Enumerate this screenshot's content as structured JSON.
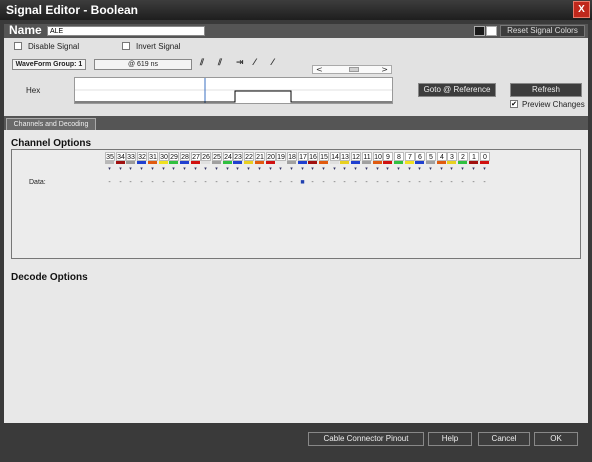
{
  "window": {
    "title": "Signal Editor - Boolean",
    "close_label": "X"
  },
  "name_row": {
    "label": "Name",
    "value": "ALE",
    "reset_label": "Reset Signal Colors",
    "swatch_colors": [
      "#1a1a1a",
      "#ffffff"
    ]
  },
  "options": {
    "disable_label": "Disable Signal",
    "invert_label": "Invert Signal",
    "preview_label": "Preview Changes",
    "preview_checked": "✔"
  },
  "toolbar": {
    "waveform_group": "WaveForm Group: 1",
    "time": "@ 619 ns",
    "scroll_left": "<",
    "scroll_right": ">"
  },
  "wave": {
    "label": "Hex"
  },
  "buttons": {
    "goto": "Goto @ Reference",
    "refresh": "Refresh",
    "cable": "Cable Connector Pinout",
    "help": "Help",
    "cancel": "Cancel",
    "ok": "OK"
  },
  "tabs": {
    "channels": "Channels and Decoding"
  },
  "channel_options": {
    "title": "Channel Options",
    "data_label": "Data:",
    "channels": [
      "35",
      "34",
      "33",
      "32",
      "31",
      "30",
      "29",
      "28",
      "27",
      "26",
      "25",
      "24",
      "23",
      "22",
      "21",
      "20",
      "19",
      "18",
      "17",
      "16",
      "15",
      "14",
      "13",
      "12",
      "11",
      "10",
      "9",
      "8",
      "7",
      "6",
      "5",
      "4",
      "3",
      "2",
      "1",
      "0"
    ],
    "colors": [
      "#b8b8b8",
      "#a01010",
      "#9a9a9a",
      "#1f3fd0",
      "#e05a10",
      "#f0e020",
      "#30c040",
      "#1f3fd0",
      "#d01010",
      "#e0e0e0",
      "#a0a0a0",
      "#30c040",
      "#1f3fd0",
      "#e8d020",
      "#e05a10",
      "#d01010",
      "#e8e8e8",
      "#a0a0a0",
      "#1f3fd0",
      "#a01010",
      "#e05a10",
      "#e0e0e0",
      "#e8d020",
      "#1f3fd0",
      "#a0a0a0",
      "#e05a10",
      "#d01010",
      "#30c040",
      "#f0e020",
      "#1f3fd0",
      "#a0a0a0",
      "#e05a10",
      "#e8d020",
      "#30c040",
      "#a01010",
      "#d01010"
    ],
    "data_values": [
      "-",
      "-",
      "-",
      "-",
      "-",
      "-",
      "-",
      "-",
      "-",
      "-",
      "-",
      "-",
      "-",
      "-",
      "-",
      "-",
      "-",
      "-",
      "■",
      "-",
      "-",
      "-",
      "-",
      "-",
      "-",
      "-",
      "-",
      "-",
      "-",
      "-",
      "-",
      "-",
      "-",
      "-",
      "-",
      "-"
    ],
    "icon_glyph": "▾"
  },
  "decode_options": {
    "title": "Decode Options"
  }
}
